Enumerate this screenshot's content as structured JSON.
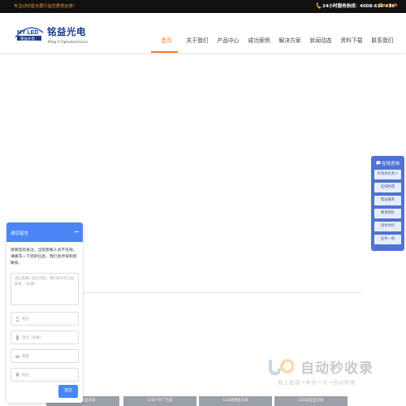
{
  "topbar": {
    "slogan": "专注LED显示屏行业优质供应商！",
    "hotline": "24小时服务热线：4008-616-619",
    "language": "English"
  },
  "brand": {
    "logo_text_top": "MY LED",
    "logo_text_bottom": "铭益光电",
    "name_cn": "铭益光电",
    "name_en": "Ming Yi Optoelectronics"
  },
  "nav": {
    "items": [
      "首页",
      "关于我们",
      "产品中心",
      "成功案例",
      "解决方案",
      "新闻动态",
      "资料下载",
      "联系我们"
    ],
    "active_index": 0
  },
  "chat": {
    "title": "请您留言",
    "intro": "感谢您的关注，当前客服人员不在线，请填写一下您的信息，我们会尽快和您联系。",
    "message_placeholder": "请在此输入留言内容，我们会尽快与您联系。（必填）",
    "name_placeholder": "姓名",
    "phone_placeholder": "电话（必填）",
    "email_placeholder": "邮箱",
    "address_placeholder": "地址",
    "submit_label": "提交"
  },
  "side_panel": {
    "title": "在线咨询",
    "items": [
      "大项目负责人",
      "区域经理",
      "售前服务",
      "精英团队",
      "项目合作",
      "业务一组"
    ]
  },
  "bottom_tabs": [
    "LED户内显示屏",
    "LED户外广告屏",
    "LED透明显示屏",
    "LED异型显示屏"
  ],
  "watermark": {
    "title": "自动秒收录",
    "subtitle": "数上链接→来访一次→自动收录"
  },
  "colors": {
    "accent_orange": "#ff7a22",
    "brand_blue": "#1b3a8c",
    "chat_blue": "#4a86f5",
    "side_blue": "#4f73d4",
    "topbar_bg": "#111111"
  }
}
